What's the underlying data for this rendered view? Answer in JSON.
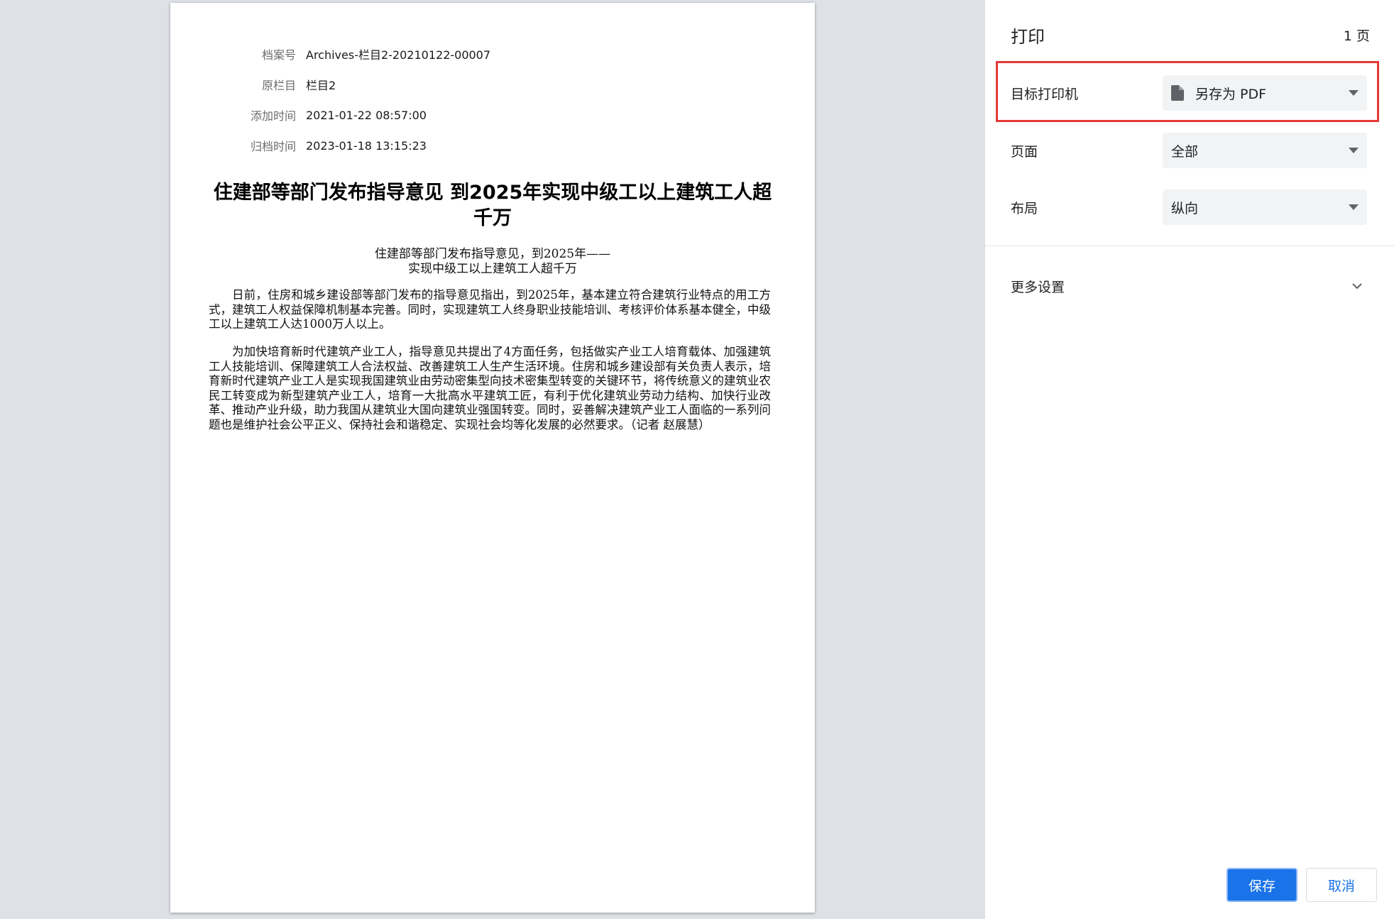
{
  "document": {
    "meta": [
      {
        "label": "档案号",
        "value": "Archives-栏目2-20210122-00007"
      },
      {
        "label": "原栏目",
        "value": "栏目2"
      },
      {
        "label": "添加时间",
        "value": "2021-01-22 08:57:00"
      },
      {
        "label": "归档时间",
        "value": "2023-01-18 13:15:23"
      }
    ],
    "title_line1": "住建部等部门发布指导意见 到2025年实现中级工以上建筑工人超",
    "title_line2": "千万",
    "subtitle_line1": "住建部等部门发布指导意见，到2025年——",
    "subtitle_line2": "实现中级工以上建筑工人超千万",
    "paragraphs": [
      "日前，住房和城乡建设部等部门发布的指导意见指出，到2025年，基本建立符合建筑行业特点的用工方式，建筑工人权益保障机制基本完善。同时，实现建筑工人终身职业技能培训、考核评价体系基本健全，中级工以上建筑工人达1000万人以上。",
      "为加快培育新时代建筑产业工人，指导意见共提出了4方面任务，包括做实产业工人培育载体、加强建筑工人技能培训、保障建筑工人合法权益、改善建筑工人生产生活环境。住房和城乡建设部有关负责人表示，培育新时代建筑产业工人是实现我国建筑业由劳动密集型向技术密集型转变的关键环节，将传统意义的建筑业农民工转变成为新型建筑产业工人，培育一大批高水平建筑工匠，有利于优化建筑业劳动力结构、加快行业改革、推动产业升级，助力我国从建筑业大国向建筑业强国转变。同时，妥善解决建筑产业工人面临的一系列问题也是维护社会公平正义、保持社会和谐稳定、实现社会均等化发展的必然要求。（记者  赵展慧）"
    ]
  },
  "panel": {
    "title": "打印",
    "page_count": "1 页",
    "destination": {
      "label": "目标打印机",
      "value": "另存为 PDF",
      "icon": "file-icon"
    },
    "pages": {
      "label": "页面",
      "value": "全部"
    },
    "layout": {
      "label": "布局",
      "value": "纵向"
    },
    "more_settings": {
      "label": "更多设置",
      "icon": "chevron-down-icon"
    },
    "save_label": "保存",
    "cancel_label": "取消"
  },
  "colors": {
    "accent": "#1a73e8",
    "highlight": "#e53935",
    "background": "#dee1e6"
  }
}
